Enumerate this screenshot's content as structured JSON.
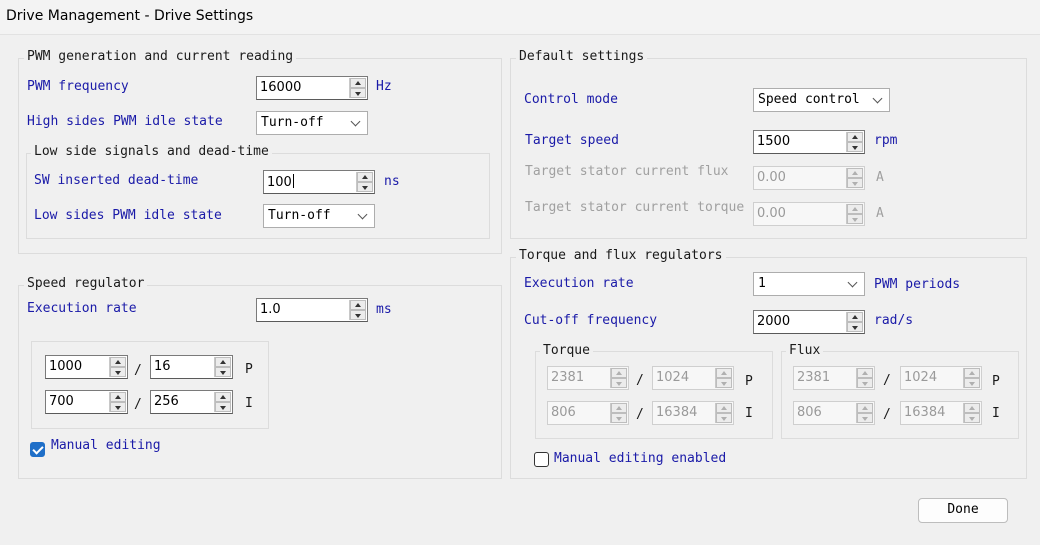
{
  "window": {
    "title": "Drive Management - Drive Settings"
  },
  "pwm": {
    "title": "PWM generation and current reading",
    "freq_label": "PWM frequency",
    "freq_value": "16000",
    "freq_unit": "Hz",
    "high_idle_label": "High sides PWM idle state",
    "high_idle_value": "Turn-off",
    "low": {
      "title": "Low side signals and dead-time",
      "deadtime_label": "SW inserted dead-time",
      "deadtime_value": "100",
      "deadtime_unit": "ns",
      "low_idle_label": "Low sides PWM idle state",
      "low_idle_value": "Turn-off"
    }
  },
  "speed": {
    "title": "Speed regulator",
    "exec_label": "Execution rate",
    "exec_value": "1.0",
    "exec_unit": "ms",
    "p_num": "1000",
    "p_den": "16",
    "p_label": "P",
    "i_num": "700",
    "i_den": "256",
    "i_label": "I",
    "slash": "/",
    "manual_label": "Manual editing",
    "manual_checked": true
  },
  "defaults": {
    "title": "Default settings",
    "control_label": "Control mode",
    "control_value": "Speed control",
    "target_speed_label": "Target speed",
    "target_speed_value": "1500",
    "target_speed_unit": "rpm",
    "flux_label": "Target stator current flux",
    "flux_value": "0.00",
    "flux_unit": "A",
    "torque_label": "Target stator current torque",
    "torque_value": "0.00",
    "torque_unit": "A"
  },
  "regulators": {
    "title": "Torque and flux regulators",
    "exec_label": "Execution rate",
    "exec_value": "1",
    "exec_unit": "PWM periods",
    "cutoff_label": "Cut-off frequency",
    "cutoff_value": "2000",
    "cutoff_unit": "rad/s",
    "torque": {
      "title": "Torque",
      "p_num": "2381",
      "p_den": "1024",
      "i_num": "806",
      "i_den": "16384"
    },
    "flux": {
      "title": "Flux",
      "p_num": "2381",
      "p_den": "1024",
      "i_num": "806",
      "i_den": "16384"
    },
    "p_label": "P",
    "i_label": "I",
    "slash": "/",
    "manual_label": "Manual editing enabled",
    "manual_checked": false
  },
  "done_label": "Done",
  "colors": {
    "label_blue": "#1a1aa8",
    "check_blue": "#1f6fc8",
    "disabled_gray": "#a0a0a0"
  }
}
